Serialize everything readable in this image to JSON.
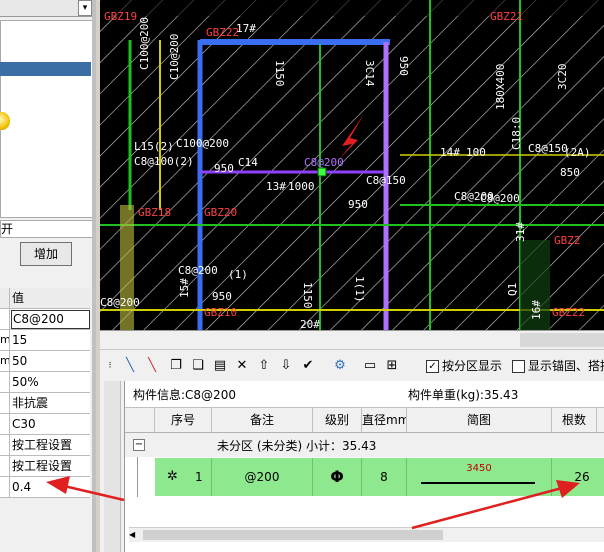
{
  "left_panel": {
    "search_suffix": "开",
    "add_button": "增加",
    "props_header_value": "值",
    "props": [
      {
        "key": "",
        "value": "C8@200",
        "editing": true
      },
      {
        "key": "m",
        "value": "15"
      },
      {
        "key": "m",
        "value": "50"
      },
      {
        "key": "",
        "value": "50%"
      },
      {
        "key": "",
        "value": "非抗震"
      },
      {
        "key": "",
        "value": "C30"
      },
      {
        "key": "",
        "value": "按工程设置"
      },
      {
        "key": "",
        "value": "按工程设置"
      },
      {
        "key": "",
        "value": "0.4"
      }
    ]
  },
  "cad": {
    "labels": [
      "GBZ19",
      "GBZ21",
      "C100@200",
      "C10@200",
      "GBZ22",
      "1150",
      "3C14",
      "950",
      "3C20",
      "L15(2)",
      "C8@100(2)",
      "C100@200",
      "C14",
      "950",
      "13#",
      "1000",
      "C8@150",
      "950",
      "14#",
      "100",
      "C8@150",
      "(2A)",
      "850",
      "C8@200",
      "GBZ18",
      "GBZ20",
      "GBZ2",
      "GBZ10",
      "C8@200",
      "(1)",
      "15#",
      "950",
      "C8@200",
      "20#",
      "1150",
      "1(1)",
      "31#",
      "16#",
      "GBZ22",
      "Q1",
      "C8@200",
      "C8@200",
      "180X400",
      "C18:0",
      "17#"
    ]
  },
  "toolbar": {
    "by_zone_label": "按分区显示",
    "by_zone_checked": true,
    "show_anchor_label": "显示锚固、搭接"
  },
  "table": {
    "component_info": "构件信息:C8@200",
    "unit_weight": "构件单重(kg):35.43",
    "headers": [
      "序号",
      "备注",
      "级别",
      "直径mm",
      "简图",
      "根数"
    ],
    "group_row": "未分区 (未分类)   小计：35.43",
    "rows": [
      {
        "index": "1",
        "note": "@200",
        "grade_icon": "steel-grade-icon",
        "diameter": "8",
        "sketch_length": "3450",
        "count": "26"
      }
    ]
  },
  "colors": {
    "cad_bg": "#000000",
    "row_highlight": "#8ee88e",
    "annotation_arrow": "#e02020"
  }
}
